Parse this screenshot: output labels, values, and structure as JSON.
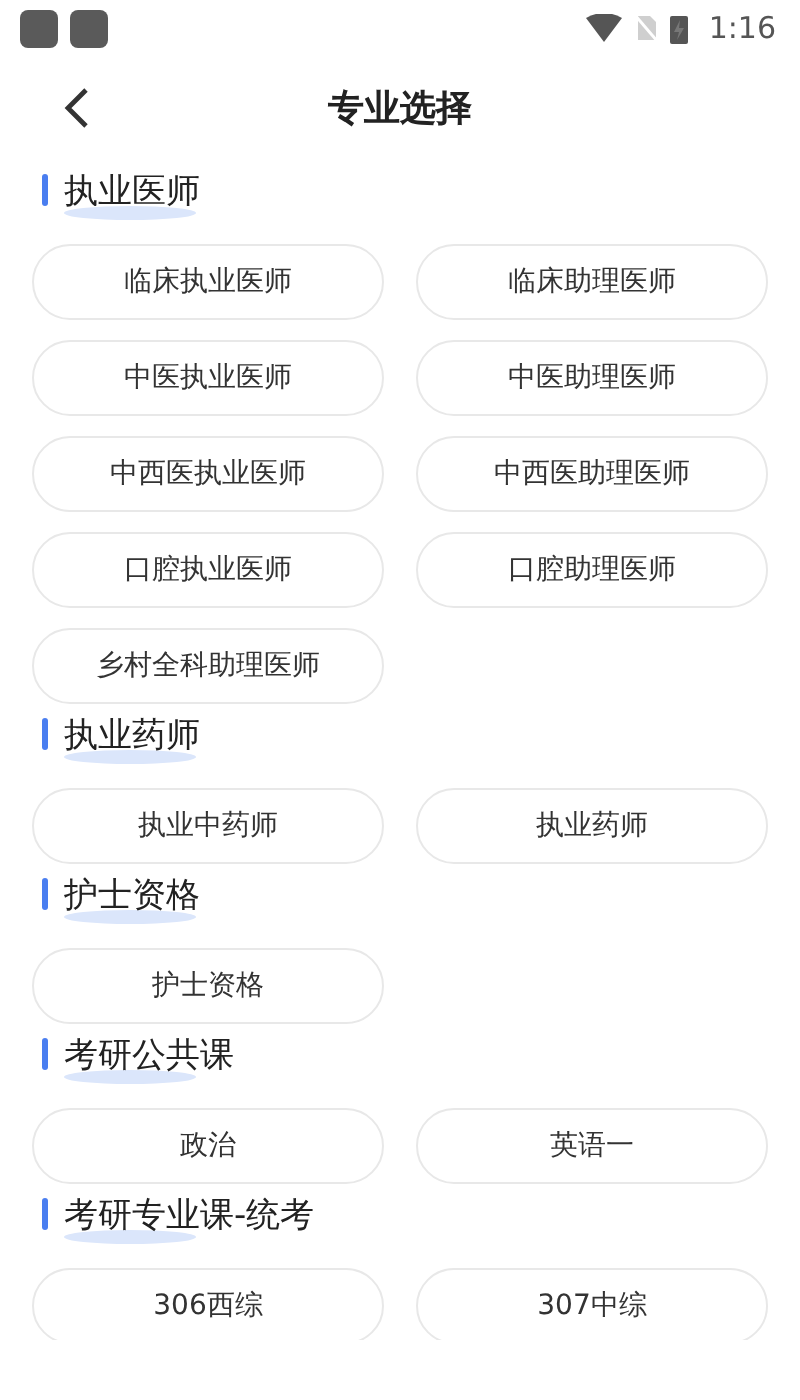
{
  "status_bar": {
    "time": "1:16"
  },
  "header": {
    "title": "专业选择"
  },
  "sections": [
    {
      "title": "执业医师",
      "options": [
        "临床执业医师",
        "临床助理医师",
        "中医执业医师",
        "中医助理医师",
        "中西医执业医师",
        "中西医助理医师",
        "口腔执业医师",
        "口腔助理医师",
        "乡村全科助理医师"
      ]
    },
    {
      "title": "执业药师",
      "options": [
        "执业中药师",
        "执业药师"
      ]
    },
    {
      "title": "护士资格",
      "options": [
        "护士资格"
      ]
    },
    {
      "title": "考研公共课",
      "options": [
        "政治",
        "英语一"
      ]
    },
    {
      "title": "考研专业课-统考",
      "options": [
        "306西综",
        "307中综"
      ]
    }
  ]
}
